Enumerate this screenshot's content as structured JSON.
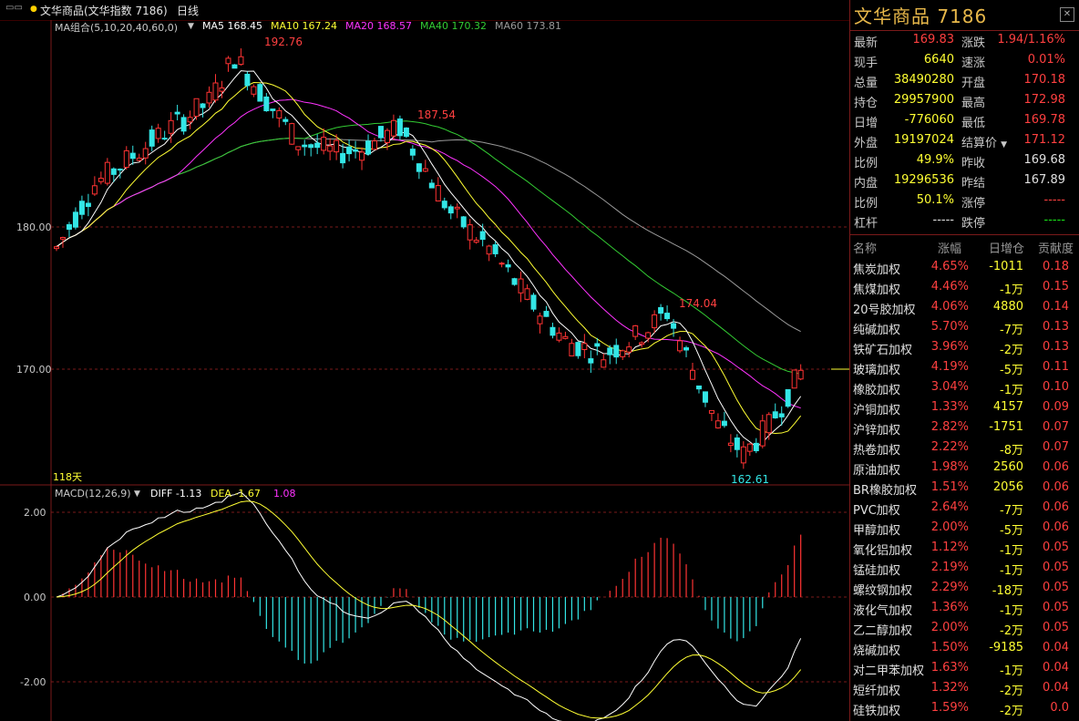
{
  "window": {
    "tab_icon": "▭▭",
    "title": "文华商品(文华指数 7186)",
    "period": "日线"
  },
  "indicators": {
    "ma_group": "MA组合(5,10,20,40,60,0)",
    "ma5": "MA5 168.45",
    "ma10": "MA10 167.24",
    "ma20": "MA20 168.57",
    "ma40": "MA40 170.32",
    "ma60": "MA60 173.81",
    "macd": "MACD(12,26,9)",
    "diff": "DIFF -1.13",
    "dea": "DEA -1.67",
    "macd_val": "1.08",
    "days": "118天",
    "colors": {
      "ma5": "#ffffff",
      "ma10": "#ffff33",
      "ma20": "#ff33ff",
      "ma40": "#33cc33",
      "ma60": "#999999"
    }
  },
  "chart_labels": {
    "high1": "192.76",
    "high2": "187.54",
    "high3": "174.04",
    "low1": "162.61",
    "y180": "180.00",
    "y170": "170.00",
    "m2": "2.00",
    "m0": "0.00",
    "mn2": "-2.00"
  },
  "panel": {
    "title": "文华商品  7186",
    "quote_rows": [
      {
        "l": "最新",
        "v": "169.83",
        "vc": "red",
        "l2": "涨跌",
        "v2": "1.94/1.16%",
        "v2c": "red"
      },
      {
        "l": "现手",
        "v": "6640",
        "vc": "yellow",
        "l2": "速涨",
        "v2": "0.01%",
        "v2c": "red"
      },
      {
        "l": "总量",
        "v": "38490280",
        "vc": "yellow",
        "l2": "开盘",
        "v2": "170.18",
        "v2c": "red"
      },
      {
        "l": "持仓",
        "v": "29957900",
        "vc": "yellow",
        "l2": "最高",
        "v2": "172.98",
        "v2c": "red"
      },
      {
        "l": "日增",
        "v": "-776060",
        "vc": "yellow",
        "l2": "最低",
        "v2": "169.78",
        "v2c": "red"
      },
      {
        "l": "外盘",
        "v": "19197024",
        "vc": "yellow",
        "l2": "结算价",
        "v2": "171.12",
        "v2c": "red"
      },
      {
        "l": "比例",
        "v": "49.9%",
        "vc": "yellow",
        "l2": "昨收",
        "v2": "169.68",
        "v2c": "white"
      },
      {
        "l": "内盘",
        "v": "19296536",
        "vc": "yellow",
        "l2": "昨结",
        "v2": "167.89",
        "v2c": "white"
      },
      {
        "l": "比例",
        "v": "50.1%",
        "vc": "yellow",
        "l2": "涨停",
        "v2": "-----",
        "v2c": "red"
      },
      {
        "l": "杠杆",
        "v": "-----",
        "vc": "white",
        "l2": "跌停",
        "v2": "-----",
        "v2c": "green"
      }
    ],
    "contrib_header": {
      "name": "名称",
      "chg": "涨幅",
      "oi": "日增仓",
      "ct": "贡献度"
    },
    "contrib_rows": [
      {
        "name": "焦炭加权",
        "chg": "4.65%",
        "oi": "-1011",
        "ct": "0.18"
      },
      {
        "name": "焦煤加权",
        "chg": "4.46%",
        "oi": "-1万",
        "ct": "0.15"
      },
      {
        "name": "20号胶加权",
        "chg": "4.06%",
        "oi": "4880",
        "ct": "0.14"
      },
      {
        "name": "纯碱加权",
        "chg": "5.70%",
        "oi": "-7万",
        "ct": "0.13"
      },
      {
        "name": "铁矿石加权",
        "chg": "3.96%",
        "oi": "-2万",
        "ct": "0.13"
      },
      {
        "name": "玻璃加权",
        "chg": "4.19%",
        "oi": "-5万",
        "ct": "0.11"
      },
      {
        "name": "橡胶加权",
        "chg": "3.04%",
        "oi": "-1万",
        "ct": "0.10"
      },
      {
        "name": "沪铜加权",
        "chg": "1.33%",
        "oi": "4157",
        "ct": "0.09"
      },
      {
        "name": "沪锌加权",
        "chg": "2.82%",
        "oi": "-1751",
        "ct": "0.07"
      },
      {
        "name": "热卷加权",
        "chg": "2.22%",
        "oi": "-8万",
        "ct": "0.07"
      },
      {
        "name": "原油加权",
        "chg": "1.98%",
        "oi": "2560",
        "ct": "0.06"
      },
      {
        "name": "BR橡胶加权",
        "chg": "1.51%",
        "oi": "2056",
        "ct": "0.06"
      },
      {
        "name": "PVC加权",
        "chg": "2.64%",
        "oi": "-7万",
        "ct": "0.06"
      },
      {
        "name": "甲醇加权",
        "chg": "2.00%",
        "oi": "-5万",
        "ct": "0.06"
      },
      {
        "name": "氧化铝加权",
        "chg": "1.12%",
        "oi": "-1万",
        "ct": "0.05"
      },
      {
        "name": "锰硅加权",
        "chg": "2.19%",
        "oi": "-1万",
        "ct": "0.05"
      },
      {
        "name": "螺纹钢加权",
        "chg": "2.29%",
        "oi": "-18万",
        "ct": "0.05"
      },
      {
        "name": "液化气加权",
        "chg": "1.36%",
        "oi": "-1万",
        "ct": "0.05"
      },
      {
        "name": "乙二醇加权",
        "chg": "2.00%",
        "oi": "-2万",
        "ct": "0.05"
      },
      {
        "name": "烧碱加权",
        "chg": "1.50%",
        "oi": "-9185",
        "ct": "0.04"
      },
      {
        "name": "对二甲苯加权",
        "chg": "1.63%",
        "oi": "-1万",
        "ct": "0.04"
      },
      {
        "name": "短纤加权",
        "chg": "1.32%",
        "oi": "-2万",
        "ct": "0.04"
      },
      {
        "name": "硅铁加权",
        "chg": "1.59%",
        "oi": "-2万",
        "ct": "0.0"
      }
    ]
  }
}
